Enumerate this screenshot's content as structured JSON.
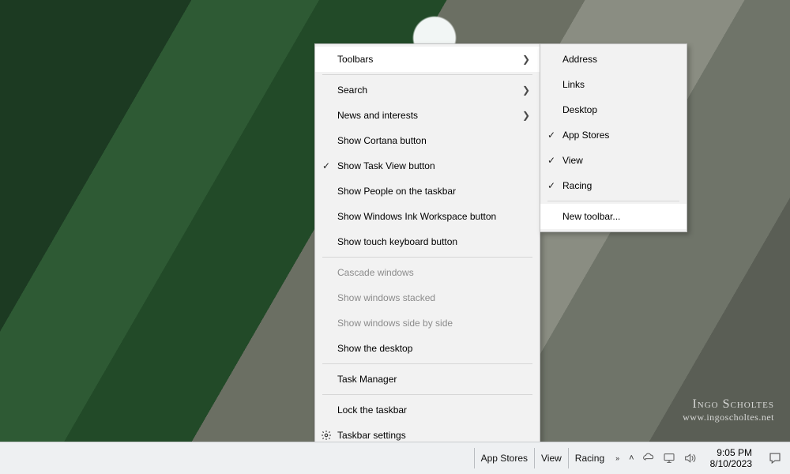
{
  "context_menu": {
    "toolbars": "Toolbars",
    "search": "Search",
    "news": "News and interests",
    "cortana": "Show Cortana button",
    "taskview": "Show Task View button",
    "people": "Show People on the taskbar",
    "ink": "Show Windows Ink Workspace button",
    "touchkb": "Show touch keyboard button",
    "cascade": "Cascade windows",
    "stacked": "Show windows stacked",
    "sidebyside": "Show windows side by side",
    "showdesktop": "Show the desktop",
    "taskmgr": "Task Manager",
    "lock": "Lock the taskbar",
    "settings": "Taskbar settings"
  },
  "toolbars_submenu": {
    "address": "Address",
    "links": "Links",
    "desktop": "Desktop",
    "appstores": "App Stores",
    "view": "View",
    "racing": "Racing",
    "new": "New toolbar..."
  },
  "taskbar": {
    "appstores": "App Stores",
    "view": "View",
    "racing": "Racing",
    "time": "9:05 PM",
    "date": "8/10/2023"
  },
  "watermark": {
    "name": "Ingo Scholtes",
    "url": "www.ingoscholtes.net"
  }
}
